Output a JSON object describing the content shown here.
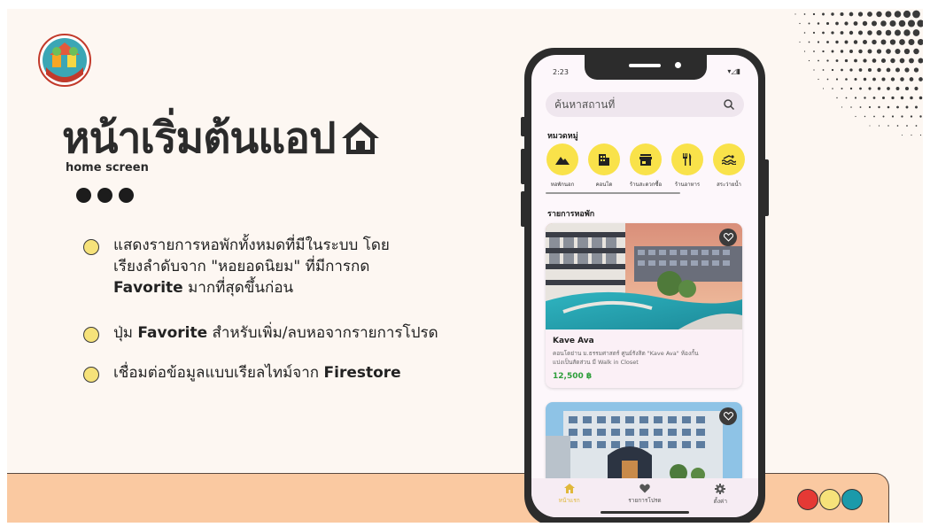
{
  "slide": {
    "title": "หน้าเริ่มต้นแอป",
    "subtitle": "home screen",
    "bullets": [
      {
        "parts": [
          "แสดงรายการหอพักทั้งหมดที่มีในระบบ โดย",
          "เรียงลำดับจาก \"หอยอดนิยม\" ที่มีการกด",
          "Favorite",
          " มากที่สุดขึ้นก่อน"
        ]
      },
      {
        "pre": "ปุ่ม ",
        "bold": "Favorite",
        "post": " สำหรับเพิ่ม/ลบหอจากรายการโปรด"
      },
      {
        "pre": "เชื่อมต่อข้อมูลแบบเรียลไทม์จาก ",
        "bold": "Firestore",
        "post": ""
      }
    ],
    "corner_dot_colors": [
      "#e53935",
      "#f6e27a",
      "#1b9aaa"
    ],
    "accent_colors": {
      "band": "#fac9a1",
      "bullet": "#f6e27a",
      "category": "#f9e24a",
      "price": "#2d9e3a"
    }
  },
  "app": {
    "status": {
      "time": "2:23",
      "icons": "▾◿▮"
    },
    "search_placeholder": "ค้นหาสถานที่",
    "categories_title": "หมวดหมู่",
    "categories": [
      {
        "label": "หอพักนอก",
        "icon": "mountain-icon"
      },
      {
        "label": "คอนโด",
        "icon": "building-icon"
      },
      {
        "label": "ร้านสะดวกซื้อ",
        "icon": "store-icon"
      },
      {
        "label": "ร้านอาหาร",
        "icon": "restaurant-icon"
      },
      {
        "label": "สระว่ายน้ำ",
        "icon": "pool-icon"
      }
    ],
    "list_title": "รายการหอพัก",
    "dorms": [
      {
        "name": "Kave Ava",
        "desc_line1": "คอนโดย่าน ม.ธรรมศาสตร์ ศูนย์รังสิต \"Kave Ava\" ห้องกั้น",
        "desc_line2": "แบ่งเป็นสัดส่วน มี Walk in Closet",
        "price": "12,500 ฿"
      }
    ],
    "nav": [
      {
        "label": "หน้าแรก",
        "icon": "home-icon"
      },
      {
        "label": "รายการโปรด",
        "icon": "heart-icon"
      },
      {
        "label": "ตั้งค่า",
        "icon": "gear-icon"
      }
    ]
  }
}
